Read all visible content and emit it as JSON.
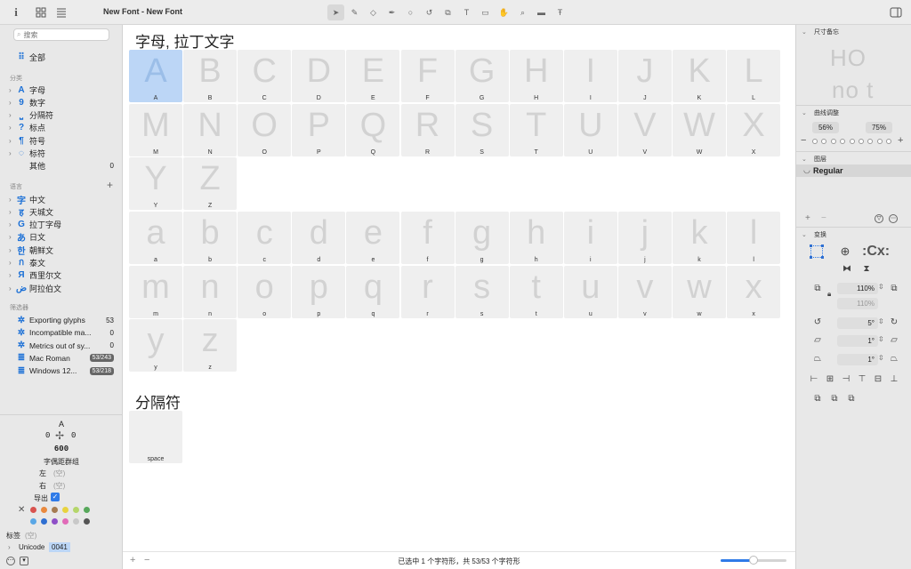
{
  "window": {
    "title": "New Font - New Font"
  },
  "sidebar": {
    "search_placeholder": "搜索",
    "all_label": "全部",
    "categories_header": "分类",
    "categories": [
      {
        "label": "字母",
        "icon": "A"
      },
      {
        "label": "数字",
        "icon": "9"
      },
      {
        "label": "分隔符",
        "icon": "⎵"
      },
      {
        "label": "标点",
        "icon": "?"
      },
      {
        "label": "符号",
        "icon": "¶"
      },
      {
        "label": "标符",
        "icon": "◌"
      }
    ],
    "other": {
      "label": "其他",
      "count": "0"
    },
    "languages_header": "语言",
    "languages": [
      {
        "label": "中文",
        "icon": "字"
      },
      {
        "label": "天城文",
        "icon": "ह"
      },
      {
        "label": "拉丁字母",
        "icon": "G"
      },
      {
        "label": "日文",
        "icon": "あ"
      },
      {
        "label": "朝鲜文",
        "icon": "한"
      },
      {
        "label": "泰文",
        "icon": "ก"
      },
      {
        "label": "西里尔文",
        "icon": "Я"
      },
      {
        "label": "阿拉伯文",
        "icon": "ض"
      }
    ],
    "filters_header": "筛选器",
    "filters": [
      {
        "label": "Exporting glyphs",
        "count": "53",
        "icon": "gear"
      },
      {
        "label": "Incompatible ma...",
        "count": "0",
        "icon": "gear"
      },
      {
        "label": "Metrics out of sy...",
        "count": "0",
        "icon": "gear"
      },
      {
        "label": "Mac Roman",
        "count": "53/243",
        "icon": "list"
      },
      {
        "label": "Windows 12...",
        "count": "53/218",
        "icon": "list"
      }
    ],
    "glyph_info": {
      "name": "A",
      "lsb": "0",
      "rsb": "0",
      "width": "600",
      "kerning_label": "字偶距群组",
      "left_label": "左",
      "left_value": "(空)",
      "right_label": "右",
      "right_value": "(空)",
      "export_label": "导出",
      "tags_label": "标签",
      "tags_value": "(空)",
      "unicode_label": "Unicode",
      "unicode_value": "0041"
    },
    "colors": [
      "#d9534f",
      "#e9893e",
      "#a57c52",
      "#e8d33f",
      "#b5d66b",
      "#57a85b",
      "#5aa7e6",
      "#2f6fd1",
      "#8e4fc7",
      "#e16bb8",
      "#c8c8c8",
      "#555555"
    ]
  },
  "canvas": {
    "section1_title": "字母, 拉丁文字",
    "uppercase": [
      "A",
      "B",
      "C",
      "D",
      "E",
      "F",
      "G",
      "H",
      "I",
      "J",
      "K",
      "L",
      "M",
      "N",
      "O",
      "P",
      "Q",
      "R",
      "S",
      "T",
      "U",
      "V",
      "W",
      "X",
      "Y",
      "Z"
    ],
    "lowercase": [
      "a",
      "b",
      "c",
      "d",
      "e",
      "f",
      "g",
      "h",
      "i",
      "j",
      "k",
      "l",
      "m",
      "n",
      "o",
      "p",
      "q",
      "r",
      "s",
      "t",
      "u",
      "v",
      "w",
      "x",
      "y",
      "z"
    ],
    "section2_title": "分隔符",
    "separators": [
      {
        "glyph": "",
        "name": "space"
      }
    ]
  },
  "status": {
    "text": "已选中 1 个字符形，共 53/53 个字符形",
    "zoom_level": 0.5
  },
  "right_panel": {
    "dimensions_header": "尺寸备忘",
    "preview_top": "HO",
    "preview_bottom": "no t",
    "curve_header": "曲线调整",
    "curve_left": "56%",
    "curve_right": "75%",
    "layers_header": "图层",
    "layer_name": "Regular",
    "transform_header": "变换",
    "scale_value": "110%",
    "scale_value2": "110%",
    "rotate_value": "5°",
    "slant_value": "1°",
    "slant_value2": "1°"
  }
}
